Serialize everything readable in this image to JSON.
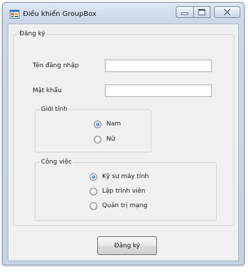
{
  "window": {
    "title": "Điều khiển GroupBox",
    "icon": "windows-form-icon",
    "controls": [
      "minimize-icon",
      "maximize-icon",
      "close-icon"
    ]
  },
  "form": {
    "group_title": "Đăng ký",
    "username_label": "Tên đăng nhập",
    "username_value": "",
    "password_label": "Mật khẩu",
    "password_value": "",
    "gender": {
      "title": "Giới tính",
      "options": [
        {
          "label": "Nam",
          "checked": true
        },
        {
          "label": "Nữ",
          "checked": false
        }
      ]
    },
    "job": {
      "title": "Công việc",
      "options": [
        {
          "label": "Kỹ sư máy tính",
          "checked": true
        },
        {
          "label": "Lập trình viên",
          "checked": false
        },
        {
          "label": "Quản trị mạng",
          "checked": false
        }
      ]
    },
    "submit_label": "Đăng ký"
  },
  "colors": {
    "window_frame": "#c4d3e6",
    "client_bg": "#f0f0f0",
    "radio_selected": "#1c5fb8"
  }
}
